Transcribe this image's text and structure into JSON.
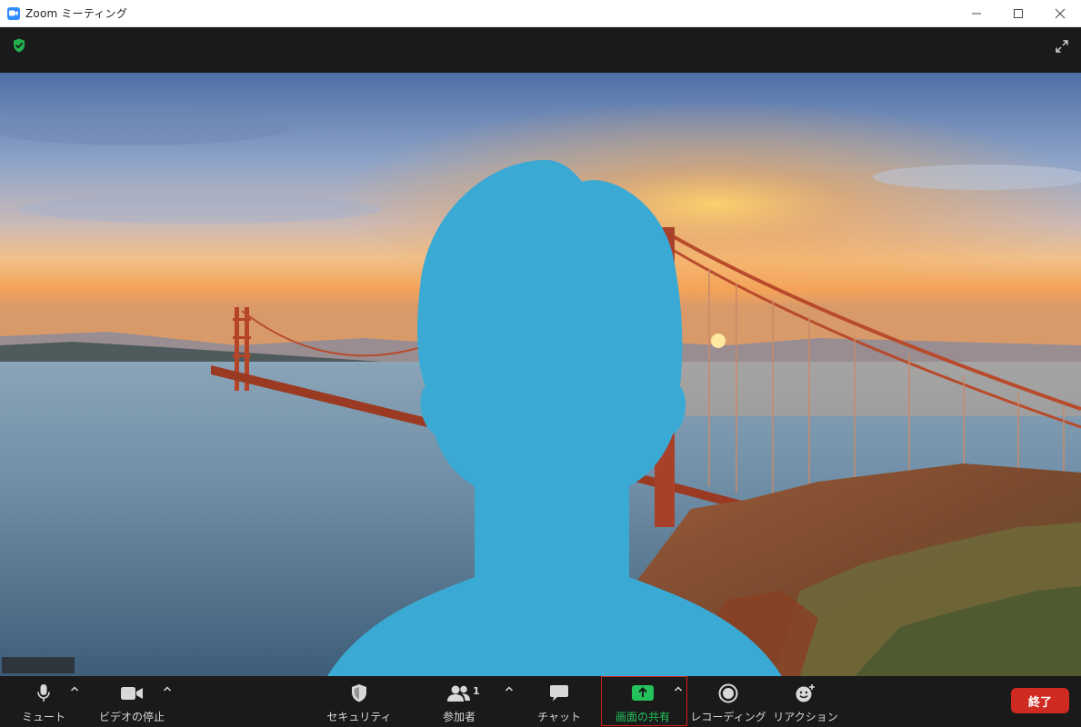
{
  "window": {
    "title": "Zoom ミーティング"
  },
  "toolbar": {
    "mute_label": "ミュート",
    "video_label": "ビデオの停止",
    "security_label": "セキュリティ",
    "participants_label": "参加者",
    "participants_count": "1",
    "chat_label": "チャット",
    "share_label": "画面の共有",
    "record_label": "レコーディング",
    "reactions_label": "リアクション",
    "end_label": "終了"
  },
  "colors": {
    "accent_blue": "#2d8cff",
    "share_green": "#24c25a",
    "end_red": "#cf2a22",
    "highlight_red": "#d61f1f",
    "avatar_blue": "#3aa9d4",
    "shield_green": "#23b14d"
  },
  "icons": {
    "app": "zoom-camera-icon",
    "minimize": "minimize-icon",
    "maximize": "maximize-icon",
    "close": "close-icon",
    "encryption": "shield-check-icon",
    "fullscreen": "expand-icon",
    "mic": "microphone-icon",
    "video": "video-camera-icon",
    "security": "shield-icon",
    "participants": "people-icon",
    "chat": "chat-bubble-icon",
    "share": "share-screen-icon",
    "record": "record-icon",
    "reactions": "emoji-add-icon"
  }
}
